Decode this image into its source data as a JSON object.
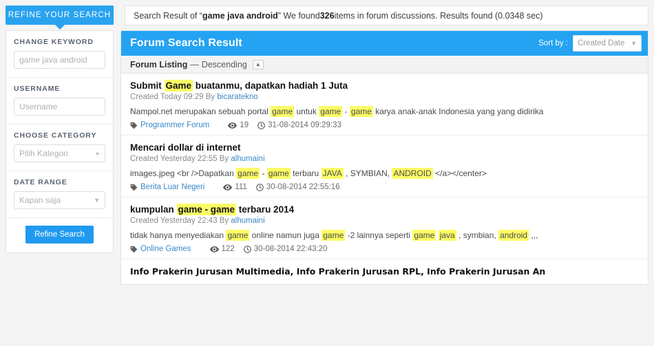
{
  "refine_tab": {
    "label": "REFINE YOUR SEARCH"
  },
  "search_info": {
    "prefix": "Search Result of “",
    "query": "game java android",
    "middle": "” We found ",
    "count": "326",
    "suffix": " items in forum discussions. Results found (0.0348 sec)"
  },
  "sidebar": {
    "filters": [
      {
        "label": "CHANGE KEYWORD",
        "placeholder": "game java android",
        "value": "",
        "icon": ""
      },
      {
        "label": "USERNAME",
        "placeholder": "Username",
        "value": "",
        "icon": ""
      },
      {
        "label": "CHOOSE CATEGORY",
        "placeholder": "Pilih Kategori",
        "value": "",
        "icon": "caret-right-icon"
      },
      {
        "label": "DATE RANGE",
        "placeholder": "Kapan saja",
        "value": "",
        "icon": "caret-down-icon"
      }
    ],
    "refine_button": "Refine Search"
  },
  "results_panel": {
    "title": "Forum Search Result",
    "sort_by_label": "Sort by :",
    "sort_value": "Created Date",
    "sort_caret_icon": "caret-down-icon",
    "listing_label": "Forum Listing",
    "listing_dash": "—",
    "listing_order": "Descending",
    "listing_toggle_icon": "caret-up-icon"
  },
  "results": [
    {
      "title_parts": [
        {
          "text": "Submit ",
          "hl": false
        },
        {
          "text": "Game",
          "hl": true
        },
        {
          "text": " buatanmu, dapatkan hadiah 1 Juta",
          "hl": false
        }
      ],
      "created_prefix": "Created Today 09:29 By ",
      "author": "bicaratekno",
      "snippet_parts": [
        {
          "text": "Nampol.net merupakan sebuah portal ",
          "hl": false
        },
        {
          "text": "game",
          "hl": true
        },
        {
          "text": " untuk ",
          "hl": false
        },
        {
          "text": "game",
          "hl": true
        },
        {
          "text": " - ",
          "hl": false
        },
        {
          "text": "game",
          "hl": true
        },
        {
          "text": " karya anak-anak Indonesia yang yang didirika",
          "hl": false
        }
      ],
      "category": "Programmer Forum",
      "views": "19",
      "date": "31-08-2014 09:29:33",
      "title_font": "condensed"
    },
    {
      "title_parts": [
        {
          "text": "Mencari dollar di internet",
          "hl": false
        }
      ],
      "created_prefix": "Created Yesterday 22:55 By ",
      "author": "alhumaini",
      "snippet_parts": [
        {
          "text": "images.jpeg <br />Dapatkan ",
          "hl": false
        },
        {
          "text": "game",
          "hl": true
        },
        {
          "text": " - ",
          "hl": false
        },
        {
          "text": "game",
          "hl": true
        },
        {
          "text": " terbaru ",
          "hl": false
        },
        {
          "text": "JAVA",
          "hl": true
        },
        {
          "text": " , SYMBIAN, ",
          "hl": false
        },
        {
          "text": "ANDROID",
          "hl": true
        },
        {
          "text": " </a></center>",
          "hl": false
        }
      ],
      "category": "Berita Luar Negeri",
      "views": "111",
      "date": "30-08-2014 22:55:16",
      "title_font": "condensed"
    },
    {
      "title_parts": [
        {
          "text": "kumpulan ",
          "hl": false
        },
        {
          "text": "game - game",
          "hl": true
        },
        {
          "text": " terbaru 2014",
          "hl": false
        }
      ],
      "created_prefix": "Created Yesterday 22:43 By ",
      "author": "alhumaini",
      "snippet_parts": [
        {
          "text": "tidak hanya menyediakan ",
          "hl": false
        },
        {
          "text": "game",
          "hl": true
        },
        {
          "text": " online namun juga ",
          "hl": false
        },
        {
          "text": "game",
          "hl": true
        },
        {
          "text": " -2 lainnya seperti ",
          "hl": false
        },
        {
          "text": "game",
          "hl": true
        },
        {
          "text": " ",
          "hl": false
        },
        {
          "text": "java",
          "hl": true
        },
        {
          "text": " , symbian, ",
          "hl": false
        },
        {
          "text": "android",
          "hl": true
        },
        {
          "text": " ,,,",
          "hl": false
        }
      ],
      "category": "Online Games",
      "views": "122",
      "date": "30-08-2014 22:43:20",
      "title_font": "condensed"
    },
    {
      "title_parts": [
        {
          "text": "Info Prakerin Jurusan Multimedia, Info Prakerin Jurusan RPL, Info Prakerin Jurusan An",
          "hl": false
        }
      ],
      "created_prefix": "",
      "author": "",
      "snippet_parts": [],
      "category": "",
      "views": "",
      "date": "",
      "title_font": "alt"
    }
  ],
  "icons": {
    "tag": "tag-icon",
    "eye": "eye-icon",
    "clock": "clock-icon"
  },
  "colors": {
    "accent_blue": "#23a3f2",
    "tab_blue": "#29a3f0",
    "button_blue": "#1f9af0",
    "highlight_yellow": "#fcfc66",
    "link_blue": "#3a89c9"
  }
}
